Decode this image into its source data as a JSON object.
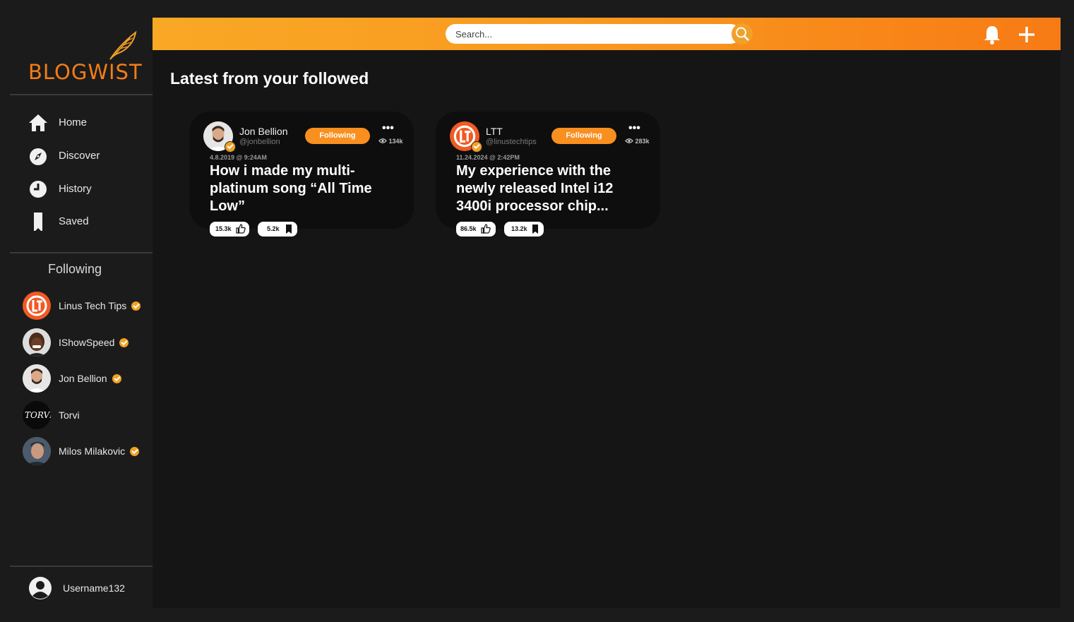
{
  "app": {
    "name": "BLOGWIST"
  },
  "colors": {
    "accent": "#f7941d",
    "background": "#1b1b1c",
    "card": "#0e0e0e"
  },
  "nav": {
    "items": [
      {
        "label": "Home",
        "icon": "home-icon"
      },
      {
        "label": "Discover",
        "icon": "compass-icon"
      },
      {
        "label": "History",
        "icon": "clock-icon"
      },
      {
        "label": "Saved",
        "icon": "bookmark-icon"
      }
    ]
  },
  "following": {
    "title": "Following",
    "items": [
      {
        "name": "Linus Tech Tips",
        "verified": true
      },
      {
        "name": "IShowSpeed",
        "verified": true
      },
      {
        "name": "Jon Bellion",
        "verified": true
      },
      {
        "name": "Torvi",
        "verified": false,
        "avatar_text": "TORVI"
      },
      {
        "name": "Milos Milakovic",
        "verified": true
      }
    ]
  },
  "user": {
    "name": "Username132"
  },
  "header": {
    "search_placeholder": "Search..."
  },
  "page": {
    "title": "Latest from your followed"
  },
  "posts": [
    {
      "author": "Jon Bellion",
      "handle": "@jonbellion",
      "follow_label": "Following",
      "more": "•••",
      "views": "134k",
      "date": "4.8.2019 @ 9:24AM",
      "title": "How i made my multi-platinum song “All Time Low”",
      "likes": "15.3k",
      "saves": "5.2k"
    },
    {
      "author": "LTT",
      "handle": "@linustechtips",
      "follow_label": "Following",
      "more": "•••",
      "views": "283k",
      "date": "11.24.2024 @ 2:42PM",
      "title": "My experience with the newly released Intel i12 3400i processor chip...",
      "likes": "86.5k",
      "saves": "13.2k"
    }
  ]
}
